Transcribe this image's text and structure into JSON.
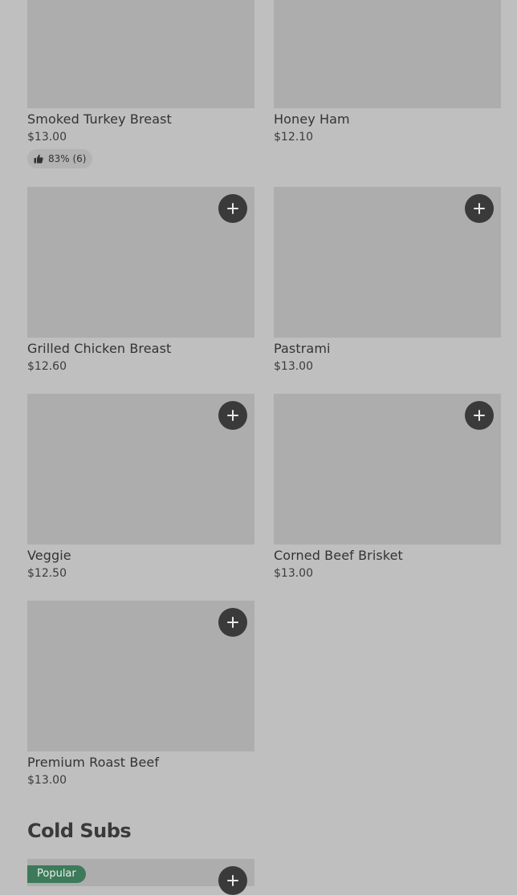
{
  "items": [
    {
      "name": "Smoked Turkey Breast",
      "price": "$13.00",
      "rating": "83% (6)"
    },
    {
      "name": "Honey Ham",
      "price": "$12.10"
    },
    {
      "name": "Grilled Chicken Breast",
      "price": "$12.60"
    },
    {
      "name": "Pastrami",
      "price": "$13.00"
    },
    {
      "name": "Veggie",
      "price": "$12.50"
    },
    {
      "name": "Corned Beef Brisket",
      "price": "$13.00"
    },
    {
      "name": "Premium Roast Beef",
      "price": "$13.00"
    }
  ],
  "section": {
    "title": "Cold Subs",
    "badge": "Popular"
  },
  "icons": {
    "add": "plus-icon",
    "rating": "thumbs-up-icon"
  },
  "colors": {
    "background": "#bfbfbf",
    "placeholder": "#adadad",
    "add_button": "#3a3a3a",
    "badge": "#3d7a5a"
  }
}
